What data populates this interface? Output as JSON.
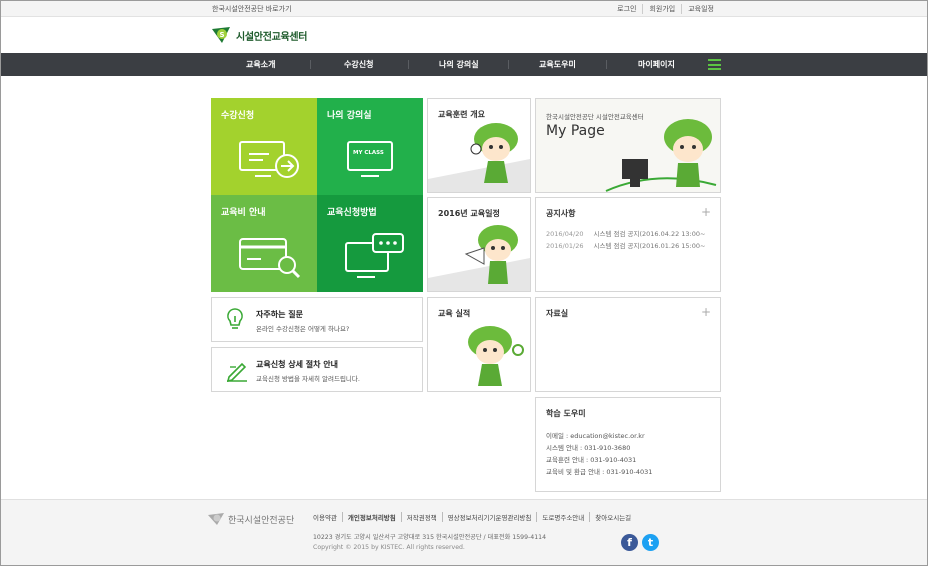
{
  "topbar": {
    "shortcut": "한국시설안전공단 바로가기",
    "links": [
      "로그인",
      "회원가입",
      "교육일정"
    ]
  },
  "logo": {
    "title": "시설안전교육센터"
  },
  "nav": {
    "items": [
      "교육소개",
      "수강신청",
      "나의 강의실",
      "교육도우미",
      "마이페이지"
    ]
  },
  "tiles": {
    "enroll": "수강신청",
    "my_lecture": "나의 강의실",
    "my_class_screen": "MY CLASS",
    "fee": "교육비 안내",
    "method": "교육신청방법",
    "colors": {
      "enroll": "#a3d22d",
      "my_lecture": "#22b04b",
      "fee": "#6bbd45",
      "method": "#159a3e"
    }
  },
  "boxes": {
    "overview": "교육훈련 개요",
    "schedule": "2016년 교육일정",
    "results": "교육 실적"
  },
  "mypage": {
    "subtitle": "한국시설안전공단 시설안전교육센터",
    "title": "My Page"
  },
  "notice": {
    "title": "공지사항",
    "items": [
      {
        "date": "2016/04/20",
        "text": "시스템 점검 공지(2016.04.22 13:00~"
      },
      {
        "date": "2016/01/26",
        "text": "시스템 점검 공지(2016.01.26 15:00~"
      }
    ]
  },
  "archive": {
    "title": "자료실"
  },
  "faq": {
    "title": "자주하는 질문",
    "subtitle": "온라인 수강신청은 어떻게 하나요?"
  },
  "apply": {
    "title": "교육신청 상세 절차 안내",
    "subtitle": "교육신청 방법을 자세히 알려드립니다."
  },
  "help": {
    "title": "학습 도우미",
    "lines": [
      "이메일 : education@kistec.or.kr",
      "시스템 안내 : 031-910-3680",
      "교육훈련 안내 : 031-910-4031",
      "교육비 및 환급 안내 : 031-910-4031"
    ]
  },
  "footer": {
    "logo_text": "한국시설안전공단",
    "links": [
      "이용약관",
      "개인정보처리방침",
      "저작권정책",
      "영상정보처리기기운영관리방침",
      "도로명주소안내",
      "찾아오시는길"
    ],
    "address": "10223   경기도 고양시 일산서구 고양대로 315 한국시설안전공단  / 대표전화 1599-4114",
    "copyright": "Copyright © 2015 by KISTEC. All rights reserved.",
    "facebook": "f",
    "twitter": "t"
  }
}
